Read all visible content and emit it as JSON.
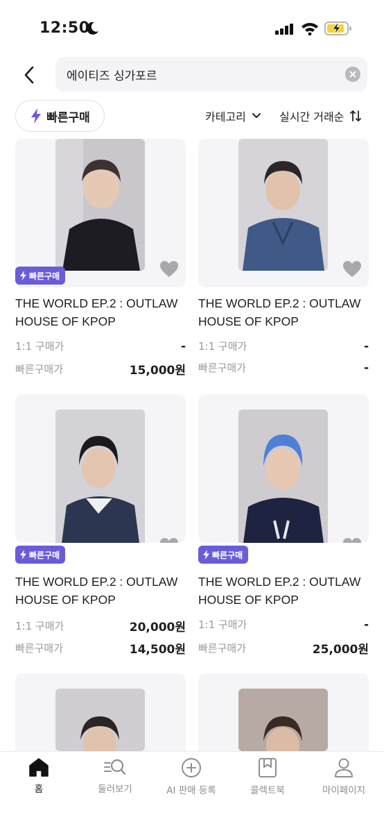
{
  "status_bar": {
    "time": "12:50"
  },
  "search": {
    "query": "에이티즈 싱가포르"
  },
  "filters": {
    "quick_buy_label": "빠른구매",
    "category_label": "카테고리",
    "sort_label": "실시간 거래순"
  },
  "products": [
    {
      "title_line1": "THE WORLD EP.2 : OUTLAW",
      "title_line2": "HOUSE OF KPOP",
      "badge": "빠른구매",
      "price_1to1_label": "1:1 구매가",
      "price_1to1": "-",
      "quick_price_label": "빠른구매가",
      "quick_price": "15,000원"
    },
    {
      "title_line1": "THE WORLD EP.2 : OUTLAW",
      "title_line2": "HOUSE OF KPOP",
      "badge": "",
      "price_1to1_label": "1:1 구매가",
      "price_1to1": "-",
      "quick_price_label": "빠른구매가",
      "quick_price": "-"
    },
    {
      "title_line1": "THE WORLD EP.2 : OUTLAW",
      "title_line2": "HOUSE OF KPOP",
      "badge": "빠른구매",
      "price_1to1_label": "1:1 구매가",
      "price_1to1": "20,000원",
      "quick_price_label": "빠른구매가",
      "quick_price": "14,500원"
    },
    {
      "title_line1": "THE WORLD EP.2 : OUTLAW",
      "title_line2": "HOUSE OF KPOP",
      "badge": "빠른구매",
      "price_1to1_label": "1:1 구매가",
      "price_1to1": "-",
      "quick_price_label": "빠른구매가",
      "quick_price": "25,000원"
    }
  ],
  "bottom_nav": [
    {
      "label": "홈",
      "icon": "home-icon",
      "active": true
    },
    {
      "label": "둘러보기",
      "icon": "browse-icon",
      "active": false
    },
    {
      "label": "AI 판매 등록",
      "icon": "plus-circle-icon",
      "active": false
    },
    {
      "label": "콜렉트북",
      "icon": "bookmark-book-icon",
      "active": false
    },
    {
      "label": "마이페이지",
      "icon": "person-icon",
      "active": false
    }
  ],
  "colors": {
    "accent": "#6a5cd9",
    "muted_text": "#9a9aa0",
    "heart": "#a8a8ad"
  }
}
